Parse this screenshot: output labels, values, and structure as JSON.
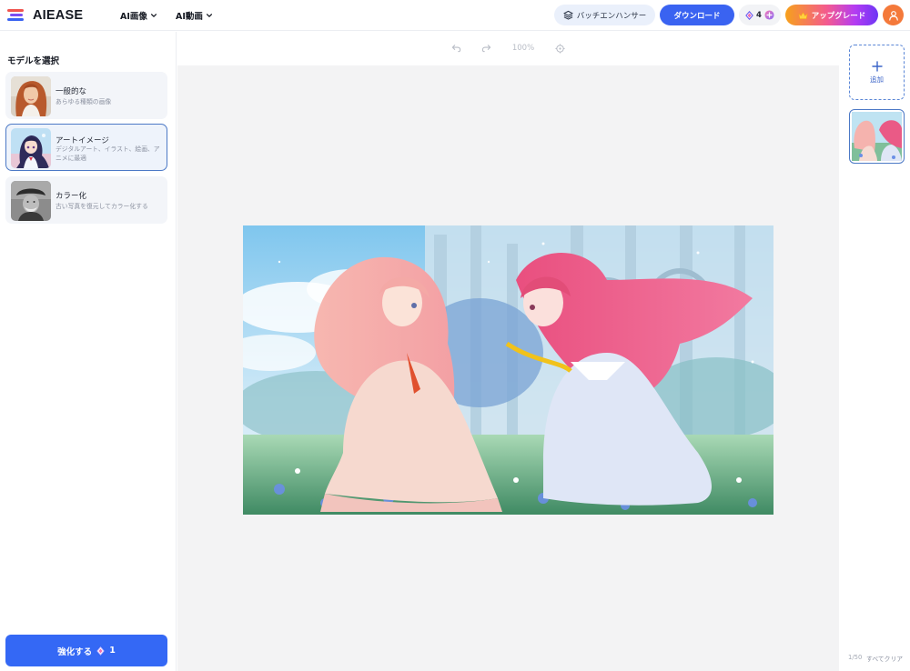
{
  "header": {
    "logo_text": "AIEASE",
    "nav": [
      {
        "label": "AI画像"
      },
      {
        "label": "AI動画"
      }
    ],
    "batch_label": "バッチエンハンサー",
    "download_label": "ダウンロード",
    "credits": "4",
    "upgrade_label": "アップグレード"
  },
  "sidebar": {
    "title": "モデルを選択",
    "models": [
      {
        "name": "一般的な",
        "desc": "あらゆる種類の画像"
      },
      {
        "name": "アートイメージ",
        "desc": "デジタルアート、イラスト、絵画、アニメに最適"
      },
      {
        "name": "カラー化",
        "desc": "古い写真を復元してカラー化する"
      }
    ],
    "enhance_label": "強化する",
    "enhance_cost": "1"
  },
  "toolbar": {
    "zoom": "100%"
  },
  "rightpanel": {
    "add_label": "追加",
    "count": "1/50",
    "clear_label": "すべてクリア"
  },
  "colors": {
    "accent": "#3468f5",
    "selected_border": "#4c79c6",
    "avatar": "#f4793a"
  },
  "icons": [
    "layers-icon",
    "diamond-icon",
    "plus-circle-icon",
    "crown-icon",
    "user-icon",
    "undo-icon",
    "redo-icon",
    "reset-icon",
    "plus-icon",
    "chevron-down-icon"
  ]
}
